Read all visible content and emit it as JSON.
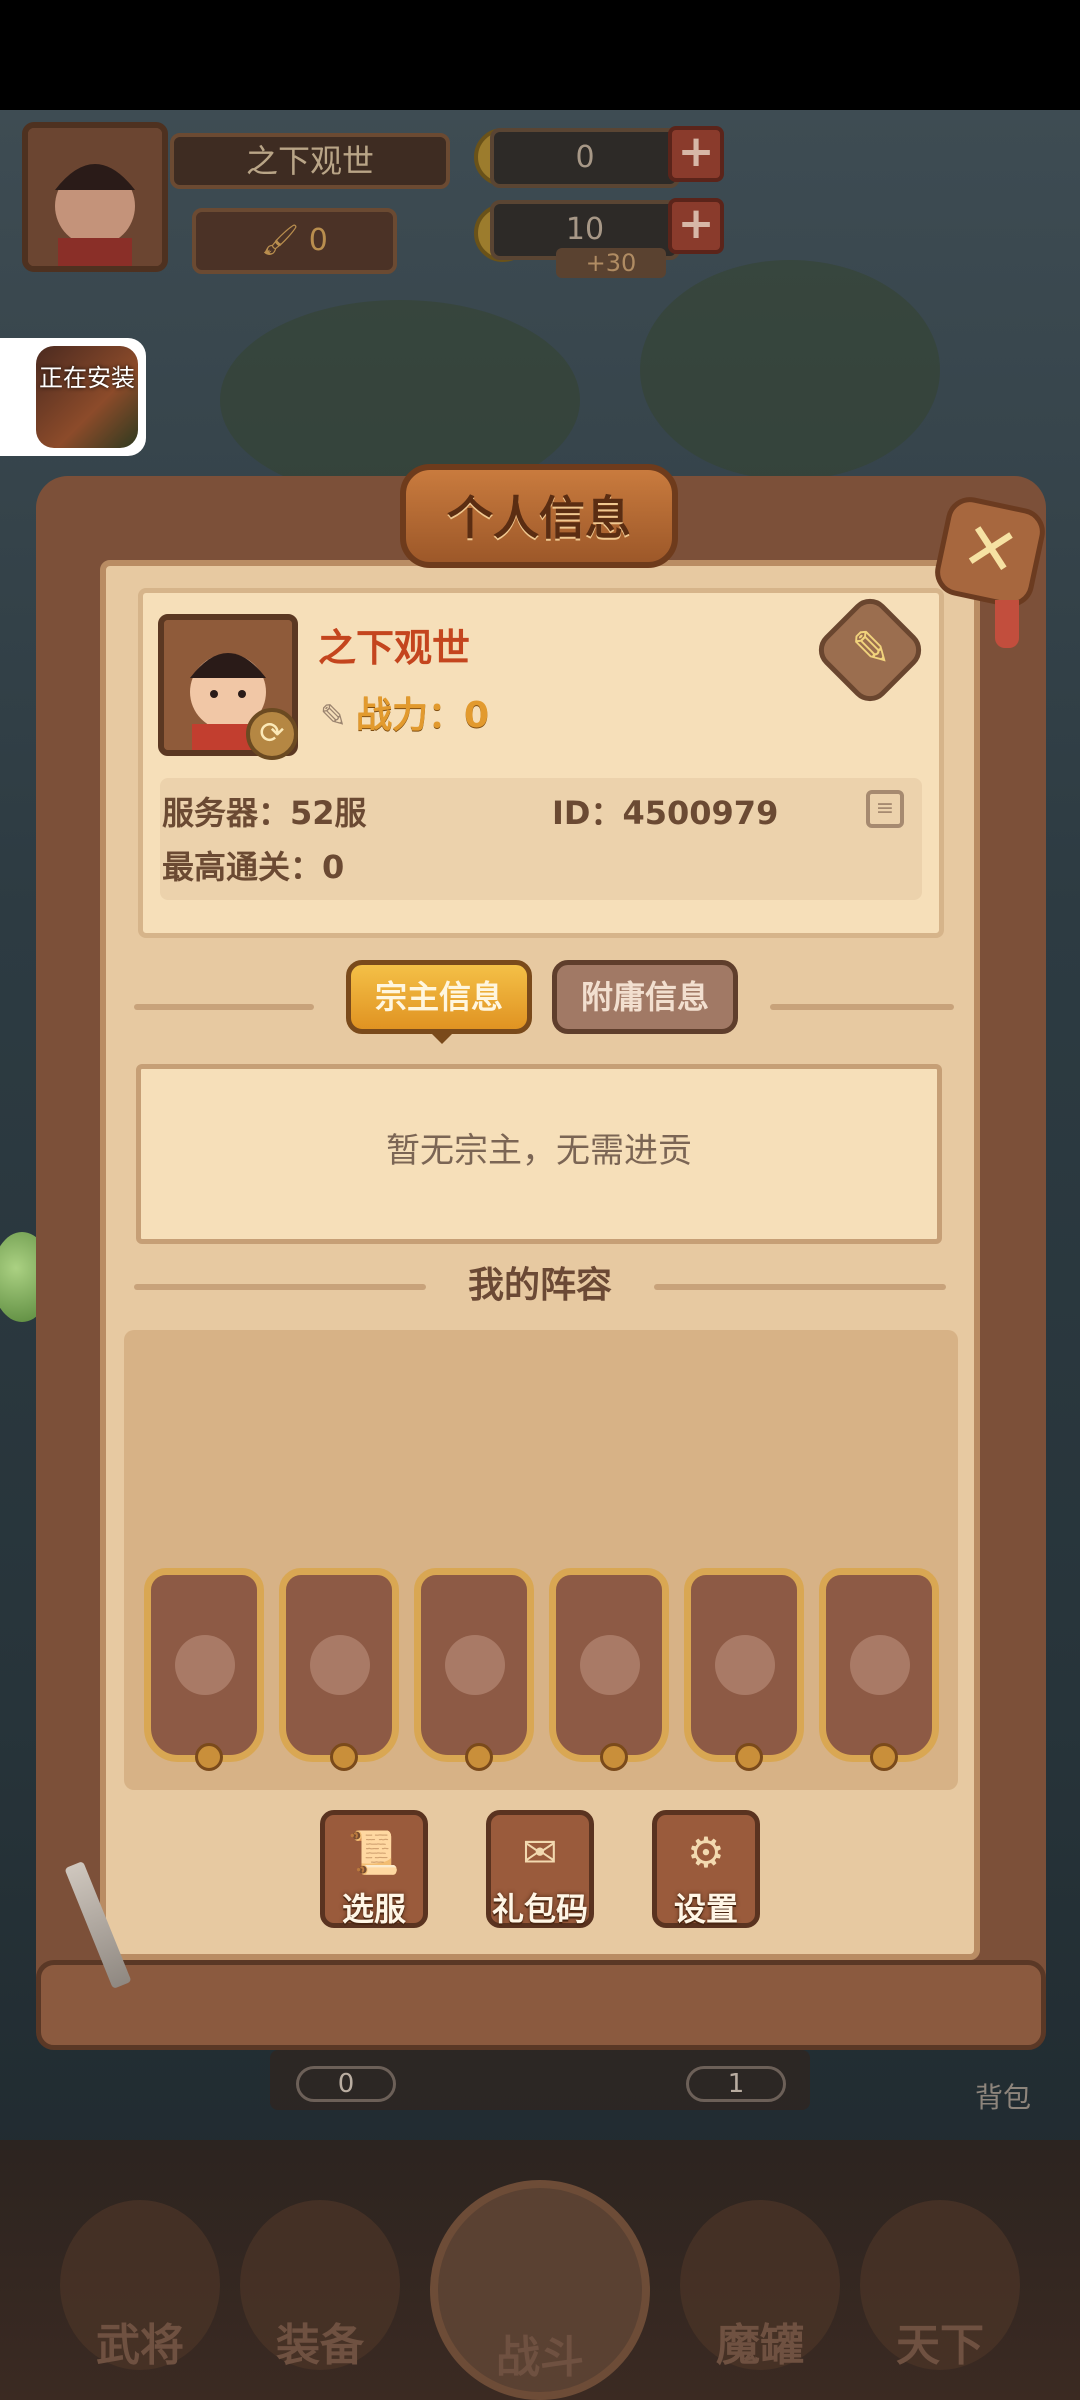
{
  "hud": {
    "player_name": "之下观世",
    "power_value": "0",
    "ingot_count": "0",
    "coin_count": "10",
    "coin_bonus": "+30"
  },
  "install_overlay": {
    "text": "正在安装"
  },
  "panel": {
    "title": "个人信息",
    "profile": {
      "name": "之下观世",
      "power_label": "战力：0",
      "server": "服务器：52服",
      "id": "ID：4500979",
      "highest_clear": "最高通关：0"
    },
    "tabs": [
      {
        "label": "宗主信息",
        "active": true
      },
      {
        "label": "附庸信息",
        "active": false
      }
    ],
    "message": "暂无宗主，无需进贡",
    "lineup_title": "我的阵容",
    "actions": [
      {
        "label": "选服",
        "icon": "scroll-map-icon"
      },
      {
        "label": "礼包码",
        "icon": "gift-scroll-icon"
      },
      {
        "label": "设置",
        "icon": "gear-icon"
      }
    ]
  },
  "background_strip": {
    "left_counter": "0",
    "right_counter": "1",
    "bag_label": "背包"
  },
  "nav": {
    "items": [
      {
        "label": "武将"
      },
      {
        "label": "装备"
      },
      {
        "label": "战斗"
      },
      {
        "label": "魔罐"
      },
      {
        "label": "天下"
      }
    ]
  }
}
